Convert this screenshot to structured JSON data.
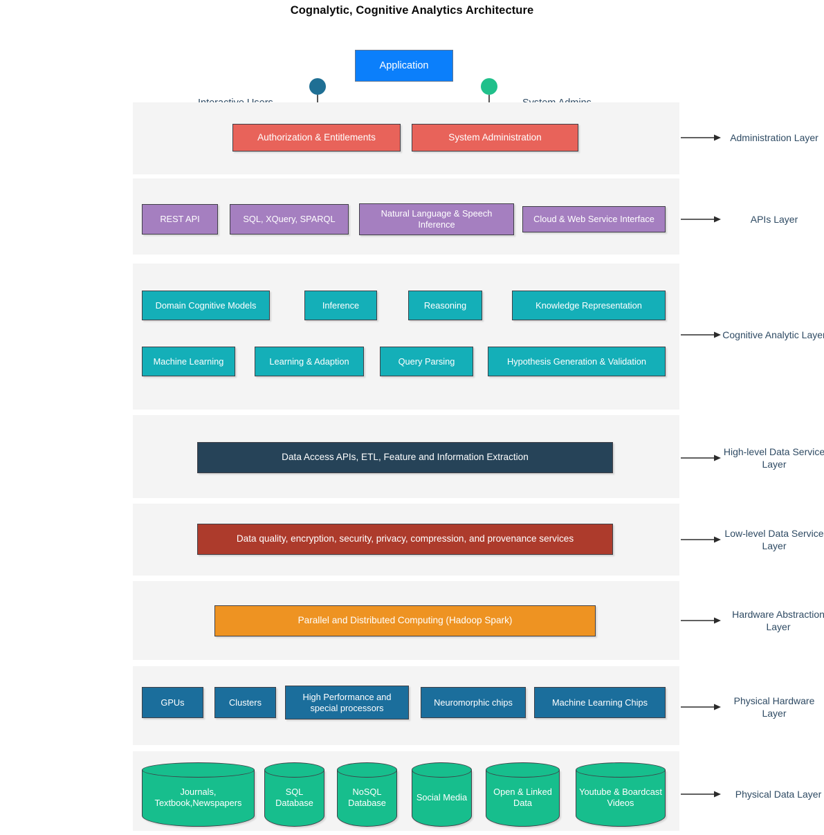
{
  "title": "Cognalytic, Cognitive Analytics Architecture",
  "actors": {
    "left_label": "Interactive Users",
    "right_label": "System Admins",
    "application_label": "Application",
    "application_color": "#0b7ffb",
    "left_head_color": "#1f6f94",
    "right_head_color": "#21c08b"
  },
  "layers": [
    {
      "annotation": "Administration Layer",
      "color": "#e8635a",
      "nodes": [
        {
          "label": "Authorization & Entitlements"
        },
        {
          "label": "System Administration"
        }
      ]
    },
    {
      "annotation": "APIs Layer",
      "color": "#a57fc0",
      "nodes": [
        {
          "label": "REST API"
        },
        {
          "label": "SQL, XQuery, SPARQL"
        },
        {
          "label": "Natural Language & Speech Inference"
        },
        {
          "label": "Cloud & Web Service Interface"
        }
      ]
    },
    {
      "annotation": "Cognitive Analytic Layer",
      "color": "#14afb8",
      "nodes": [
        {
          "label": "Domain Cognitive Models"
        },
        {
          "label": "Inference"
        },
        {
          "label": "Reasoning"
        },
        {
          "label": "Knowledge Representation"
        },
        {
          "label": "Machine Learning"
        },
        {
          "label": "Learning & Adaption"
        },
        {
          "label": "Query Parsing"
        },
        {
          "label": "Hypothesis Generation & Validation"
        }
      ]
    },
    {
      "annotation": "High-level Data Service Layer",
      "color": "#264358",
      "nodes": [
        {
          "label": "Data Access APIs, ETL, Feature and Information Extraction"
        }
      ]
    },
    {
      "annotation": "Low-level Data Service Layer",
      "color": "#ad3b2c",
      "nodes": [
        {
          "label": "Data quality, encryption, security, privacy, compression, and provenance services"
        }
      ]
    },
    {
      "annotation": "Hardware Abstraction Layer",
      "color": "#ee9322",
      "nodes": [
        {
          "label": "Parallel and Distributed Computing (Hadoop Spark)"
        }
      ]
    },
    {
      "annotation": "Physical Hardware Layer",
      "color": "#1b6e9c",
      "nodes": [
        {
          "label": "GPUs"
        },
        {
          "label": "Clusters"
        },
        {
          "label": "High Performance and special processors"
        },
        {
          "label": "Neuromorphic chips"
        },
        {
          "label": "Machine Learning Chips"
        }
      ]
    },
    {
      "annotation": "Physical Data Layer",
      "color": "#17be8d",
      "nodes": [
        {
          "label": "Journals, Textbook,Newspapers"
        },
        {
          "label": "SQL Database"
        },
        {
          "label": "NoSQL Database"
        },
        {
          "label": "Social Media"
        },
        {
          "label": "Open & Linked Data"
        },
        {
          "label": "Youtube & Boardcast Videos"
        }
      ]
    }
  ]
}
